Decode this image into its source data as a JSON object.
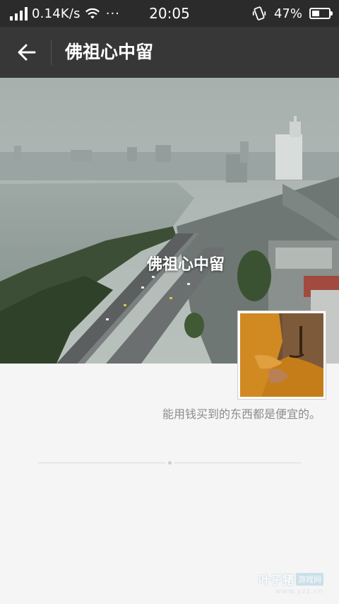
{
  "status_bar": {
    "network_speed": "0.14K/s",
    "more": "···",
    "time": "20:05",
    "battery_percent": "47%",
    "battery_level": 0.47
  },
  "title_bar": {
    "title": "佛祖心中留"
  },
  "profile": {
    "name": "佛祖心中留",
    "signature": "能用钱买到的东西都是便宜的。"
  },
  "watermark": {
    "brand": "叶子猪",
    "tag": "游戏网",
    "url": "www.yzz.cn"
  },
  "colors": {
    "statusbar_bg": "#2b2b2b",
    "titlebar_bg": "#373737",
    "page_bg": "#f5f5f5"
  }
}
